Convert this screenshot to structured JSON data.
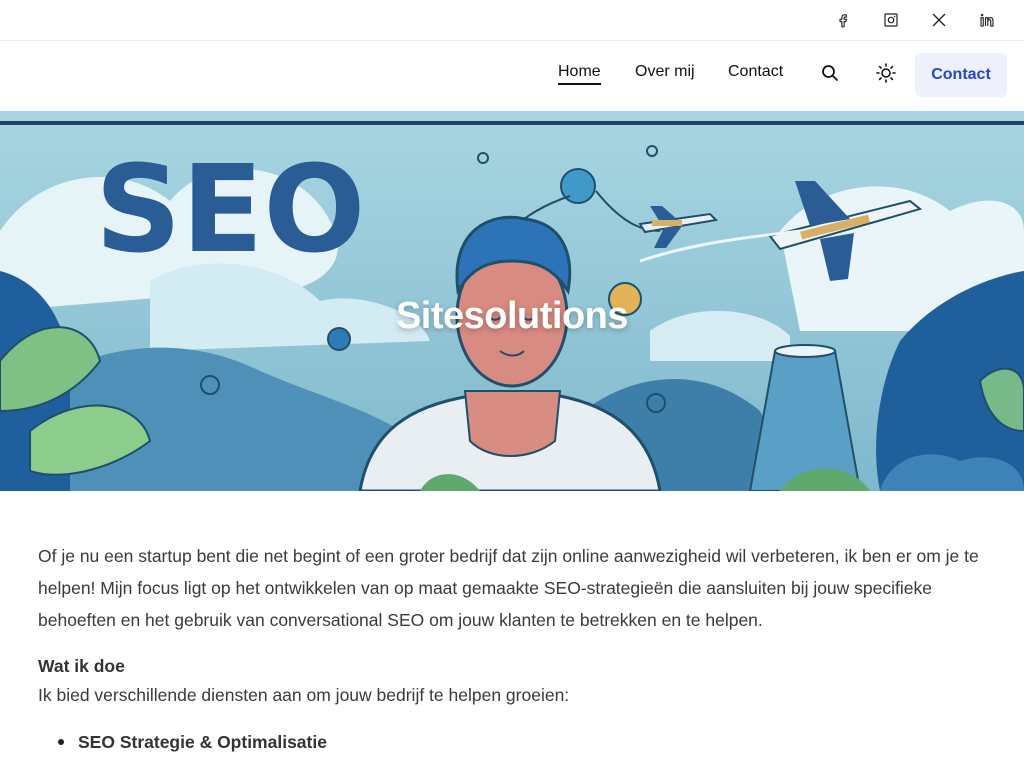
{
  "social": [
    {
      "name": "facebook-icon",
      "label": "Facebook"
    },
    {
      "name": "instagram-icon",
      "label": "Instagram"
    },
    {
      "name": "x-twitter-icon",
      "label": "X"
    },
    {
      "name": "linkedin-icon",
      "label": "LinkedIn"
    }
  ],
  "nav": {
    "items": [
      {
        "label": "Home",
        "active": true
      },
      {
        "label": "Over mij"
      },
      {
        "label": "Contact"
      }
    ],
    "search_icon": "search-icon",
    "theme_icon": "sun-icon",
    "cta_label": "Contact",
    "cta_color": "#2447c8"
  },
  "hero": {
    "title": "Sitesolutions",
    "image_text": "SEO"
  },
  "content": {
    "intro": "Of je nu een startup bent die net begint of een groter bedrijf dat zijn online aanwezigheid wil verbeteren, ik ben er om je te helpen! Mijn focus ligt op het ontwikkelen van op maat gemaakte SEO-strategieën die aansluiten bij jouw specifieke behoeften en het gebruik van conversational SEO om jouw klanten te betrekken en te helpen.",
    "section_heading": "Wat ik doe",
    "section_text": "Ik bied verschillende diensten aan om jouw bedrijf te helpen groeien:",
    "services": [
      "SEO Strategie & Optimalisatie"
    ]
  }
}
